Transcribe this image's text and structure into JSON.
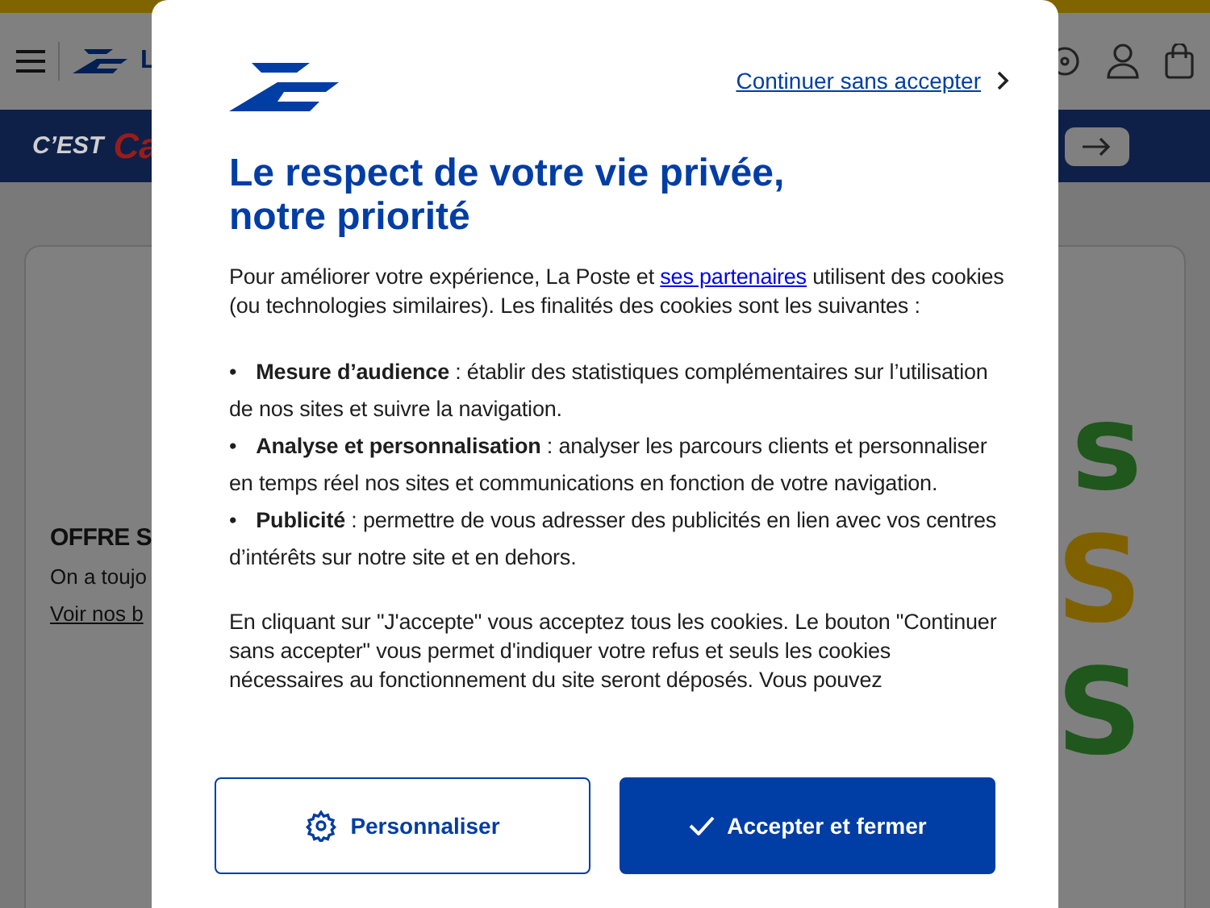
{
  "page": {
    "header": {
      "logo_text": "L"
    },
    "banner": {
      "texts": [
        "C’EST",
        "Ca"
      ]
    },
    "card": {
      "title": "OFFRE S",
      "text": "On a toujo",
      "link": "Voir nos b",
      "art_letters": [
        {
          "text": "s",
          "color": "#1f571d"
        },
        {
          "text": "S",
          "color": "#806100"
        },
        {
          "text": "S",
          "color": "#1f571d"
        }
      ]
    }
  },
  "dialog": {
    "skip_link": "Continuer sans accepter",
    "title_lines": [
      "Le respect de votre vie privée,",
      "notre priorité"
    ],
    "intro": {
      "before": "Pour améliorer votre expérience, La Poste et ",
      "link": "ses partenaires",
      "after": " utilisent des cookies (ou technologies similaires). Les finalités des cookies sont les suivantes :"
    },
    "bullets": [
      {
        "marker": "•",
        "text": "**Mesure d’audience** : établir des statistiques complémentaires sur l’utilisation de nos sites et suivre la navigation."
      },
      {
        "marker": "•",
        "text": "**Analyse et personnalisation** : analyser les parcours clients et personnaliser en temps réel nos sites et communications en fonction de votre navigation."
      },
      {
        "marker": "•",
        "text": "**Publicité** : permettre de vous adresser des publicités en lien avec vos centres d’intérêts sur notre site et en dehors."
      }
    ],
    "closing": "En cliquant sur \"J'accepte\" vous acceptez tous les cookies. Le bouton \"Continuer sans accepter\" vous permet d'indiquer votre refus et seuls les cookies nécessaires au fonctionnement du site seront déposés. Vous pouvez",
    "buttons": [
      {
        "label": "Personnaliser",
        "kind": "secondary"
      },
      {
        "label": "Accepter et fermer",
        "kind": "primary"
      }
    ]
  }
}
